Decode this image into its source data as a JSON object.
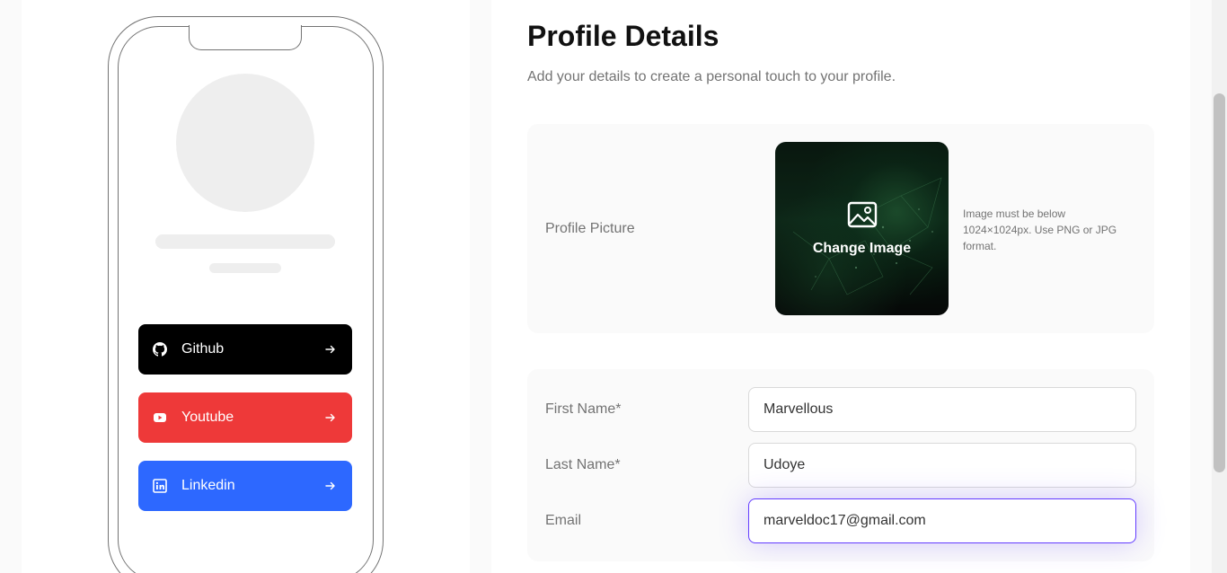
{
  "preview": {
    "links": [
      {
        "label": "Github",
        "color": "#000000",
        "icon": "github-icon"
      },
      {
        "label": "Youtube",
        "color": "#ee3939",
        "icon": "youtube-icon"
      },
      {
        "label": "Linkedin",
        "color": "#2d68ff",
        "icon": "linkedin-icon"
      }
    ]
  },
  "profile": {
    "title": "Profile Details",
    "subtitle": "Add your details to create a personal touch to your profile.",
    "picture": {
      "label": "Profile Picture",
      "change_label": "Change Image",
      "hint": "Image must be below 1024×1024px. Use PNG or JPG format."
    },
    "fields": {
      "first_name": {
        "label": "First Name*",
        "value": "Marvellous"
      },
      "last_name": {
        "label": "Last Name*",
        "value": "Udoye"
      },
      "email": {
        "label": "Email",
        "value": "marveldoc17@gmail.com"
      }
    }
  },
  "colors": {
    "accent": "#633cff",
    "github": "#000000",
    "youtube": "#ee3939",
    "linkedin": "#2d68ff"
  }
}
